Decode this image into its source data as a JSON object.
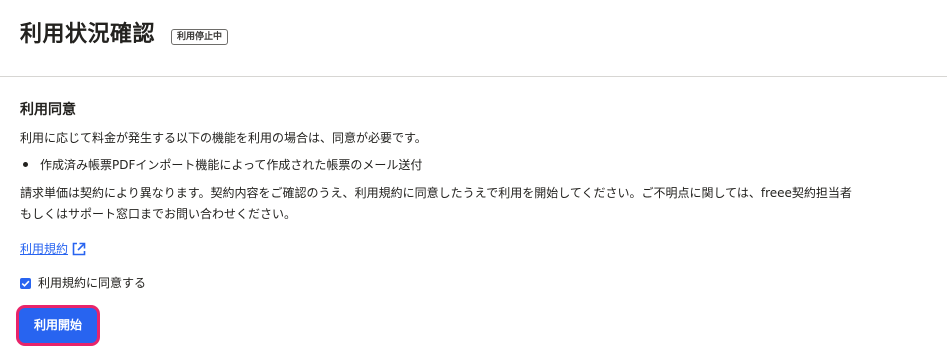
{
  "header": {
    "title": "利用状況確認",
    "status_badge": "利用停止中"
  },
  "consent": {
    "heading": "利用同意",
    "intro": "利用に応じて料金が発生する以下の機能を利用の場合は、同意が必要です。",
    "features": [
      "作成済み帳票PDFインポート機能によって作成された帳票のメール送付"
    ],
    "notice_line1": "請求単価は契約により異なります。契約内容をご確認のうえ、利用規約に同意したうえで利用を開始してください。ご不明点に関しては、freee契約担当者",
    "notice_line2": "もしくはサポート窓口までお問い合わせください。",
    "terms_link_label": "利用規約",
    "terms_link_icon": "external-link-icon",
    "agree_label": "利用規約に同意する",
    "agree_checked": true,
    "start_button_label": "利用開始"
  },
  "colors": {
    "accent": "#2864f0",
    "highlight_border": "#e8246a",
    "divider": "#d7d6d3",
    "text": "#23221f"
  }
}
